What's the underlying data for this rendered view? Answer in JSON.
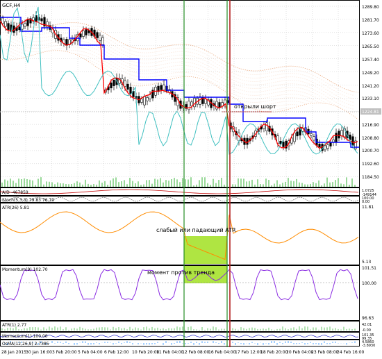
{
  "window": {
    "symbol_label": "GCF,H4"
  },
  "colors": {
    "background": "#ffffff",
    "grid": "#c8c8c8",
    "candle": "#000000",
    "kijun_blue": "#0000ff",
    "tenkan_red": "#ff0000",
    "chikou_cyan": "#40c0c0",
    "cloud_dotted": "#e8a070",
    "level_line": "#c04040",
    "atr_line": "#ff8c00",
    "momentum_line": "#8a2be2",
    "highlight": "#9acd32",
    "vline_green": "#228b22",
    "vline_red": "#b22222",
    "price_tag_bg": "#c0c0c0",
    "ao_green": "#00a000",
    "ao_red": "#c00000"
  },
  "main_chart": {
    "price_axis_labels": [
      "1289.80",
      "1281.70",
      "1273.60",
      "1265.50",
      "1257.40",
      "1249.20",
      "1241.20",
      "1233.10",
      "1224.81",
      "1216.90",
      "1208.80",
      "1200.70",
      "1192.60",
      "1184.50"
    ],
    "current_price_tag": "1224.81",
    "annotation_short": "открыли шорт"
  },
  "subwindows": {
    "ad_label": "A/D -467859",
    "ad_axis": [
      "1.0725",
      "-149144"
    ],
    "stoch_label": "Stoch(5,3,3) 79.83 76.70",
    "stoch_axis": [
      "100.00",
      "0.00"
    ],
    "atr26_label": "ATR(26) 5.81",
    "atr26_axis": [
      "11.81",
      "5.13"
    ],
    "atr_annotation": "слабый или падающий ATR",
    "momentum_label": "Momentum(9) 102.70",
    "momentum_axis": [
      "101.51",
      "100.00",
      "96.63"
    ],
    "momentum_annotation": "момент против тренда",
    "atr1_label": "ATR(1) 2.77",
    "atr1_axis": [
      "42.01",
      "-0.00"
    ],
    "momentum1_label": "Momentum(1) 100.00",
    "momentum1_axis": [
      "101.35",
      "99.35"
    ],
    "osma_label": "OsMA(12,26,9) 2.7385",
    "osma_axis": [
      "4.5860",
      "-3.8930"
    ]
  },
  "time_axis": [
    "28 Jan 2015",
    "30 Jan 16:00",
    "3 Feb 20:00",
    "5 Feb 04:00",
    "6 Feb 12:00",
    "10 Feb 20:00",
    "11 Feb 04:00",
    "12 Feb 08:00",
    "16 Feb 04:00",
    "17 Feb 12:00",
    "18 Feb 20:00",
    "20 Feb 04:00",
    "23 Feb 08:00",
    "24 Feb 16:00"
  ]
}
